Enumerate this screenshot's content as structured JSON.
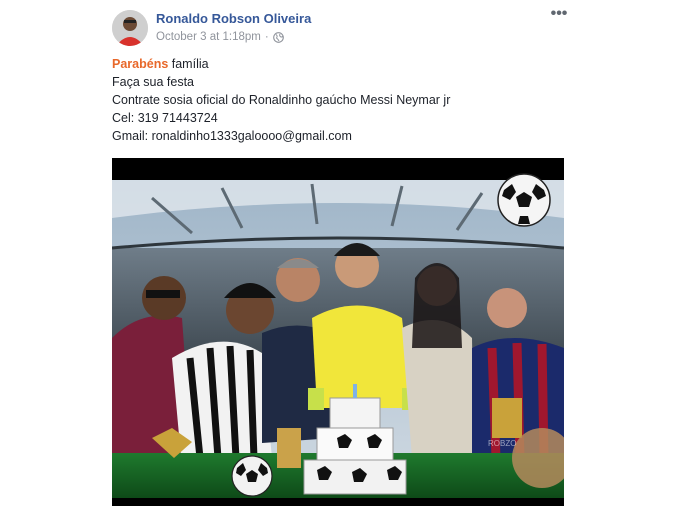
{
  "post": {
    "author": "Ronaldo Robson Oliveira",
    "timestamp": "October 3 at 1:18pm",
    "separator": "·",
    "privacy_icon": "globe-icon",
    "more_label": "•••",
    "text": {
      "highlight": "Parabéns",
      "line1_rest": " família",
      "line2": "Faça sua festa",
      "line3": "Contrate sosia oficial do Ronaldinho gaúcho Messi Neymar jr",
      "line4": "Cel: 319 71443724",
      "line5": "Gmail: ronaldinho1333galoooo@gmail.com"
    },
    "photo": {
      "watermark": "ROBZO"
    }
  },
  "colors": {
    "author": "#365899",
    "meta": "#90949c",
    "highlight": "#e8682a",
    "text": "#1d2129"
  }
}
